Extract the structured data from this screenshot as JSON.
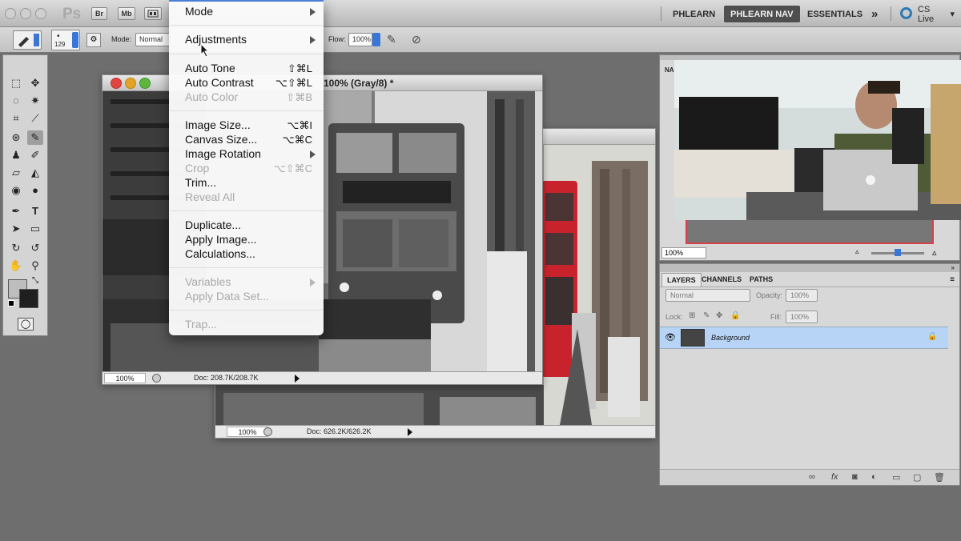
{
  "appbar": {
    "logo": "Ps",
    "bridge_label": "Br",
    "minibridge_label": "Mb",
    "workspaces": [
      "PHLEARN",
      "PHLEARN NAV",
      "ESSENTIALS"
    ],
    "more_label": "»",
    "cslive_label": "CS Live"
  },
  "options": {
    "brush_size": "129",
    "mode_label": "Mode:",
    "mode_value": "Normal",
    "flow_label": "Flow:",
    "flow_value": "100%"
  },
  "menu": {
    "items": [
      {
        "label": "Mode",
        "shortcut": "",
        "submenu": true,
        "disabled": false
      },
      {
        "label": "Adjustments",
        "shortcut": "",
        "submenu": true,
        "disabled": false
      },
      {
        "label": "Auto Tone",
        "shortcut": "⇧⌘L",
        "submenu": false,
        "disabled": false
      },
      {
        "label": "Auto Contrast",
        "shortcut": "⌥⇧⌘L",
        "submenu": false,
        "disabled": false
      },
      {
        "label": "Auto Color",
        "shortcut": "⇧⌘B",
        "submenu": false,
        "disabled": true
      },
      {
        "label": "Image Size...",
        "shortcut": "⌥⌘I",
        "submenu": false,
        "disabled": false
      },
      {
        "label": "Canvas Size...",
        "shortcut": "⌥⌘C",
        "submenu": false,
        "disabled": false
      },
      {
        "label": "Image Rotation",
        "shortcut": "",
        "submenu": true,
        "disabled": false
      },
      {
        "label": "Crop",
        "shortcut": "⌥⇧⌘C",
        "submenu": false,
        "disabled": true
      },
      {
        "label": "Trim...",
        "shortcut": "",
        "submenu": false,
        "disabled": false
      },
      {
        "label": "Reveal All",
        "shortcut": "",
        "submenu": false,
        "disabled": true
      },
      {
        "label": "Duplicate...",
        "shortcut": "",
        "submenu": false,
        "disabled": false
      },
      {
        "label": "Apply Image...",
        "shortcut": "",
        "submenu": false,
        "disabled": false
      },
      {
        "label": "Calculations...",
        "shortcut": "",
        "submenu": false,
        "disabled": false
      },
      {
        "label": "Variables",
        "shortcut": "",
        "submenu": true,
        "disabled": true
      },
      {
        "label": "Apply Data Set...",
        "shortcut": "",
        "submenu": false,
        "disabled": true
      },
      {
        "label": "Trap...",
        "shortcut": "",
        "submenu": false,
        "disabled": true
      }
    ]
  },
  "doc_front": {
    "title": "100% (Gray/8) *",
    "zoom": "100%",
    "doc_info": "Doc: 208.7K/208.7K"
  },
  "doc_back": {
    "zoom": "100%",
    "doc_info": "Doc: 626.2K/626.2K"
  },
  "navigator": {
    "tab_label": "NA",
    "zoom": "100%"
  },
  "layers": {
    "tabs": [
      "LAYERS",
      "CHANNELS",
      "PATHS"
    ],
    "blend_mode": "Normal",
    "opacity_label": "Opacity:",
    "opacity_value": "100%",
    "lock_label": "Lock:",
    "fill_label": "Fill:",
    "fill_value": "100%",
    "layer_name": "Background"
  },
  "colors": {
    "accent_blue": "#3a76d6",
    "bus_red": "#c8232c",
    "traffic_red": "#e0443e",
    "traffic_yellow": "#e3a32b",
    "traffic_green": "#5fb53d"
  }
}
